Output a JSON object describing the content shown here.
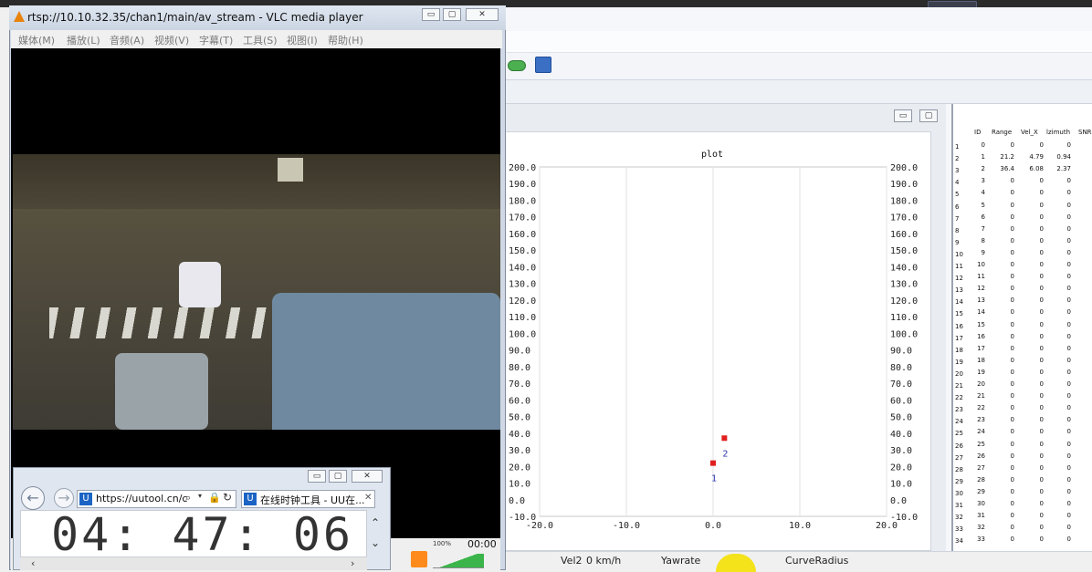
{
  "vlc": {
    "title": "rtsp://10.10.32.35/chan1/main/av_stream - VLC media player",
    "menu": [
      "媒体(M)",
      "播放(L)",
      "音频(A)",
      "视频(V)",
      "字幕(T)",
      "工具(S)",
      "视图(I)",
      "帮助(H)"
    ],
    "time": "00:00"
  },
  "browser": {
    "url": "https://uutool.cn/c",
    "tab_title": "在线时钟工具 - UU在...",
    "clock": "04: 47: 06",
    "zoom": "100%"
  },
  "plot": {
    "title": "plot",
    "y_ticks": [
      "200.0",
      "190.0",
      "180.0",
      "170.0",
      "160.0",
      "150.0",
      "140.0",
      "130.0",
      "120.0",
      "110.0",
      "100.0",
      "90.0",
      "80.0",
      "70.0",
      "60.0",
      "50.0",
      "40.0",
      "30.0",
      "20.0",
      "10.0",
      "0.0",
      "-10.0"
    ],
    "x_ticks": [
      "-20.0",
      "-10.0",
      "0.0",
      "10.0",
      "20.0"
    ],
    "point_labels": [
      "1",
      "2"
    ]
  },
  "chart_data": {
    "type": "scatter",
    "title": "plot",
    "xlim": [
      -20,
      20
    ],
    "ylim": [
      -10,
      200
    ],
    "series": [
      {
        "points": [
          {
            "x": 0.0,
            "y": 22.0,
            "label": "1"
          },
          {
            "x": 1.3,
            "y": 37.0,
            "label": "2"
          }
        ],
        "color": "#e02020"
      }
    ],
    "grid": true
  },
  "table": {
    "columns": [
      "ID",
      "Range",
      "Vel_X",
      "lzimuth",
      "SNR"
    ],
    "rows": [
      [
        "1",
        "0",
        "0",
        "0",
        "0"
      ],
      [
        "2",
        "1",
        "21.2",
        "4.79",
        "0.94"
      ],
      [
        "3",
        "2",
        "36.4",
        "6.08",
        "2.37"
      ],
      [
        "4",
        "3",
        "0",
        "0",
        "0"
      ],
      [
        "5",
        "4",
        "0",
        "0",
        "0"
      ],
      [
        "6",
        "5",
        "0",
        "0",
        "0"
      ],
      [
        "7",
        "6",
        "0",
        "0",
        "0"
      ],
      [
        "8",
        "7",
        "0",
        "0",
        "0"
      ],
      [
        "9",
        "8",
        "0",
        "0",
        "0"
      ],
      [
        "10",
        "9",
        "0",
        "0",
        "0"
      ],
      [
        "11",
        "10",
        "0",
        "0",
        "0"
      ],
      [
        "12",
        "11",
        "0",
        "0",
        "0"
      ],
      [
        "13",
        "12",
        "0",
        "0",
        "0"
      ],
      [
        "14",
        "13",
        "0",
        "0",
        "0"
      ],
      [
        "15",
        "14",
        "0",
        "0",
        "0"
      ],
      [
        "16",
        "15",
        "0",
        "0",
        "0"
      ],
      [
        "17",
        "16",
        "0",
        "0",
        "0"
      ],
      [
        "18",
        "17",
        "0",
        "0",
        "0"
      ],
      [
        "19",
        "18",
        "0",
        "0",
        "0"
      ],
      [
        "20",
        "19",
        "0",
        "0",
        "0"
      ],
      [
        "21",
        "20",
        "0",
        "0",
        "0"
      ],
      [
        "22",
        "21",
        "0",
        "0",
        "0"
      ],
      [
        "23",
        "22",
        "0",
        "0",
        "0"
      ],
      [
        "24",
        "23",
        "0",
        "0",
        "0"
      ],
      [
        "25",
        "24",
        "0",
        "0",
        "0"
      ],
      [
        "26",
        "25",
        "0",
        "0",
        "0"
      ],
      [
        "27",
        "26",
        "0",
        "0",
        "0"
      ],
      [
        "28",
        "27",
        "0",
        "0",
        "0"
      ],
      [
        "29",
        "28",
        "0",
        "0",
        "0"
      ],
      [
        "30",
        "29",
        "0",
        "0",
        "0"
      ],
      [
        "31",
        "30",
        "0",
        "0",
        "0"
      ],
      [
        "32",
        "31",
        "0",
        "0",
        "0"
      ],
      [
        "33",
        "32",
        "0",
        "0",
        "0"
      ],
      [
        "34",
        "33",
        "0",
        "0",
        "0"
      ]
    ]
  },
  "status": {
    "vel2": "Vel2",
    "vel2_value": "0 km/h",
    "yawrate": "Yawrate",
    "curve": "CurveRadius"
  },
  "colors": {
    "accent": "#e8830c",
    "marker": "#e02020"
  }
}
